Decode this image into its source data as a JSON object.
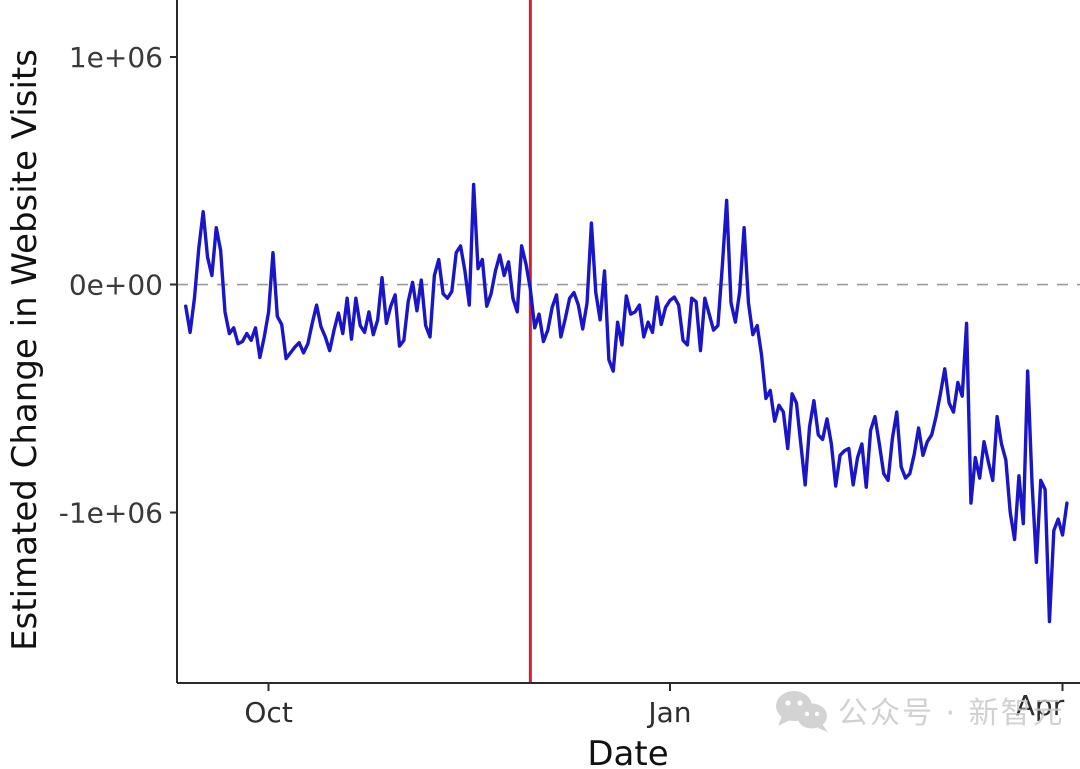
{
  "chart_data": {
    "type": "line",
    "title": "",
    "subtitle": "",
    "xlabel": "Date",
    "ylabel": "Estimated Change in Website Visits",
    "xlim": [
      "2022-09-10",
      "2023-04-05"
    ],
    "ylim": [
      -1750000,
      1250000
    ],
    "grid": false,
    "legend_position": "none",
    "y_ticks": [
      {
        "value": 1000000,
        "label": "1e+06"
      },
      {
        "value": 0,
        "label": "0e+00"
      },
      {
        "value": -1000000,
        "label": "-1e+06"
      }
    ],
    "x_ticks": [
      {
        "value": "2022-10-01",
        "label": "Oct"
      },
      {
        "value": "2023-01-01",
        "label": "Jan"
      },
      {
        "value": "2023-04-01",
        "label": "Apr"
      }
    ],
    "annotations": [
      {
        "type": "hline",
        "name": "zero-reference-line",
        "value": 0,
        "style": "dashed",
        "color": "#9a9a9a"
      },
      {
        "type": "vline",
        "name": "event-marker-line",
        "value": "2022-11-30",
        "style": "solid",
        "color": "#cf2233"
      }
    ],
    "series": [
      {
        "name": "Estimated Change in Website Visits",
        "color": "#1a16c8",
        "x": [
          "2022-09-12",
          "2022-09-13",
          "2022-09-14",
          "2022-09-15",
          "2022-09-16",
          "2022-09-17",
          "2022-09-18",
          "2022-09-19",
          "2022-09-20",
          "2022-09-21",
          "2022-09-22",
          "2022-09-23",
          "2022-09-24",
          "2022-09-25",
          "2022-09-26",
          "2022-09-27",
          "2022-09-28",
          "2022-09-29",
          "2022-09-30",
          "2022-10-01",
          "2022-10-02",
          "2022-10-03",
          "2022-10-04",
          "2022-10-05",
          "2022-10-06",
          "2022-10-07",
          "2022-10-08",
          "2022-10-09",
          "2022-10-10",
          "2022-10-11",
          "2022-10-12",
          "2022-10-13",
          "2022-10-14",
          "2022-10-15",
          "2022-10-16",
          "2022-10-17",
          "2022-10-18",
          "2022-10-19",
          "2022-10-20",
          "2022-10-21",
          "2022-10-22",
          "2022-10-23",
          "2022-10-24",
          "2022-10-25",
          "2022-10-26",
          "2022-10-27",
          "2022-10-28",
          "2022-10-29",
          "2022-10-30",
          "2022-10-31",
          "2022-11-01",
          "2022-11-02",
          "2022-11-03",
          "2022-11-04",
          "2022-11-05",
          "2022-11-06",
          "2022-11-07",
          "2022-11-08",
          "2022-11-09",
          "2022-11-10",
          "2022-11-11",
          "2022-11-12",
          "2022-11-13",
          "2022-11-14",
          "2022-11-15",
          "2022-11-16",
          "2022-11-17",
          "2022-11-18",
          "2022-11-19",
          "2022-11-20",
          "2022-11-21",
          "2022-11-22",
          "2022-11-23",
          "2022-11-24",
          "2022-11-25",
          "2022-11-26",
          "2022-11-27",
          "2022-11-28",
          "2022-11-29",
          "2022-11-30",
          "2022-12-01",
          "2022-12-02",
          "2022-12-03",
          "2022-12-04",
          "2022-12-05",
          "2022-12-06",
          "2022-12-07",
          "2022-12-08",
          "2022-12-09",
          "2022-12-10",
          "2022-12-11",
          "2022-12-12",
          "2022-12-13",
          "2022-12-14",
          "2022-12-15",
          "2022-12-16",
          "2022-12-17",
          "2022-12-18",
          "2022-12-19",
          "2022-12-20",
          "2022-12-21",
          "2022-12-22",
          "2022-12-23",
          "2022-12-24",
          "2022-12-25",
          "2022-12-26",
          "2022-12-27",
          "2022-12-28",
          "2022-12-29",
          "2022-12-30",
          "2022-12-31",
          "2023-01-01",
          "2023-01-02",
          "2023-01-03",
          "2023-01-04",
          "2023-01-05",
          "2023-01-06",
          "2023-01-07",
          "2023-01-08",
          "2023-01-09",
          "2023-01-10",
          "2023-01-11",
          "2023-01-12",
          "2023-01-13",
          "2023-01-14",
          "2023-01-15",
          "2023-01-16",
          "2023-01-17",
          "2023-01-18",
          "2023-01-19",
          "2023-01-20",
          "2023-01-21",
          "2023-01-22",
          "2023-01-23",
          "2023-01-24",
          "2023-01-25",
          "2023-01-26",
          "2023-01-27",
          "2023-01-28",
          "2023-01-29",
          "2023-01-30",
          "2023-01-31",
          "2023-02-01",
          "2023-02-02",
          "2023-02-03",
          "2023-02-04",
          "2023-02-05",
          "2023-02-06",
          "2023-02-07",
          "2023-02-08",
          "2023-02-09",
          "2023-02-10",
          "2023-02-11",
          "2023-02-12",
          "2023-02-13",
          "2023-02-14",
          "2023-02-15",
          "2023-02-16",
          "2023-02-17",
          "2023-02-18",
          "2023-02-19",
          "2023-02-20",
          "2023-02-21",
          "2023-02-22",
          "2023-02-23",
          "2023-02-24",
          "2023-02-25",
          "2023-02-26",
          "2023-02-27",
          "2023-02-28",
          "2023-03-01",
          "2023-03-02",
          "2023-03-03",
          "2023-03-04",
          "2023-03-05",
          "2023-03-06",
          "2023-03-07",
          "2023-03-08",
          "2023-03-09",
          "2023-03-10",
          "2023-03-11",
          "2023-03-12",
          "2023-03-13",
          "2023-03-14",
          "2023-03-15",
          "2023-03-16",
          "2023-03-17",
          "2023-03-18",
          "2023-03-19",
          "2023-03-20",
          "2023-03-21",
          "2023-03-22",
          "2023-03-23",
          "2023-03-24",
          "2023-03-25",
          "2023-03-26",
          "2023-03-27",
          "2023-03-28",
          "2023-03-29",
          "2023-03-30",
          "2023-03-31",
          "2023-04-01",
          "2023-04-02"
        ],
        "values": [
          -95000,
          -210000,
          -60000,
          160000,
          320000,
          120000,
          40000,
          250000,
          150000,
          -120000,
          -215000,
          -190000,
          -260000,
          -250000,
          -215000,
          -245000,
          -190000,
          -320000,
          -230000,
          -120000,
          140000,
          -140000,
          -175000,
          -325000,
          -300000,
          -275000,
          -255000,
          -300000,
          -260000,
          -170000,
          -90000,
          -185000,
          -230000,
          -290000,
          -200000,
          -125000,
          -215000,
          -60000,
          -240000,
          -60000,
          -180000,
          -210000,
          -120000,
          -220000,
          -155000,
          30000,
          -170000,
          -95000,
          -45000,
          -270000,
          -245000,
          -75000,
          10000,
          -115000,
          20000,
          -180000,
          -230000,
          40000,
          110000,
          -40000,
          -60000,
          -30000,
          140000,
          170000,
          60000,
          -90000,
          440000,
          70000,
          110000,
          -95000,
          -40000,
          60000,
          130000,
          40000,
          100000,
          -60000,
          -120000,
          170000,
          90000,
          -20000,
          -190000,
          -130000,
          -250000,
          -200000,
          -100000,
          -45000,
          -230000,
          -150000,
          -60000,
          -35000,
          -90000,
          -195000,
          -80000,
          270000,
          -35000,
          -155000,
          60000,
          -330000,
          -380000,
          -165000,
          -265000,
          -50000,
          -130000,
          -120000,
          -90000,
          -230000,
          -165000,
          -210000,
          -55000,
          -175000,
          -100000,
          -70000,
          -55000,
          -90000,
          -245000,
          -265000,
          -60000,
          -75000,
          -290000,
          -60000,
          -130000,
          -200000,
          -180000,
          80000,
          370000,
          -80000,
          -165000,
          -30000,
          250000,
          -80000,
          -220000,
          -180000,
          -310000,
          -500000,
          -465000,
          -600000,
          -530000,
          -560000,
          -720000,
          -480000,
          -520000,
          -700000,
          -880000,
          -625000,
          -510000,
          -660000,
          -680000,
          -590000,
          -700000,
          -885000,
          -750000,
          -730000,
          -720000,
          -880000,
          -760000,
          -700000,
          -890000,
          -640000,
          -580000,
          -700000,
          -830000,
          -860000,
          -675000,
          -560000,
          -800000,
          -850000,
          -830000,
          -745000,
          -630000,
          -750000,
          -690000,
          -660000,
          -580000,
          -480000,
          -370000,
          -520000,
          -560000,
          -430000,
          -490000,
          -170000,
          -960000,
          -760000,
          -850000,
          -690000,
          -780000,
          -860000,
          -580000,
          -700000,
          -770000,
          -1000000,
          -1120000,
          -840000,
          -1050000,
          -380000,
          -870000,
          -1220000,
          -860000,
          -900000,
          -1480000,
          -1080000,
          -1030000,
          -1100000,
          -960000
        ]
      }
    ]
  },
  "watermark": {
    "icon": "wechat-icon",
    "text": "公众号 · 新智元"
  }
}
